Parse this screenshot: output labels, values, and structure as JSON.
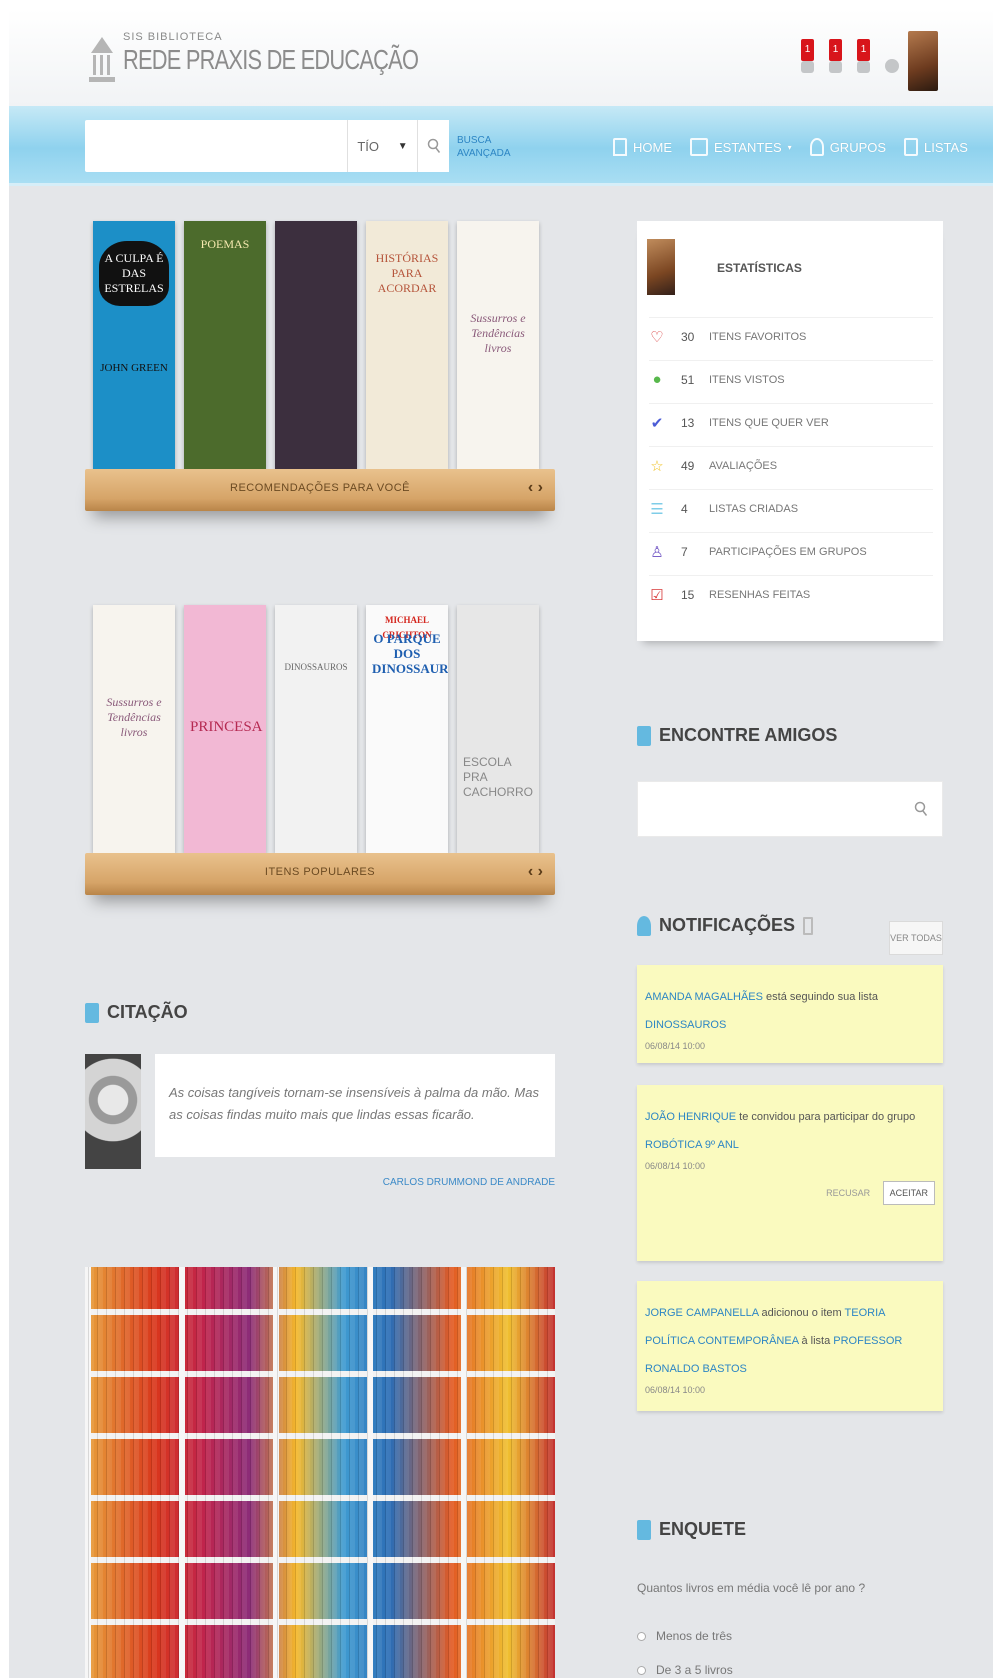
{
  "header": {
    "logo_small": "SIS BIBLIOTECA",
    "logo_big": "REDE PRAXIS DE EDUCAÇÃO",
    "notification_counts": [
      "1",
      "1",
      "1"
    ]
  },
  "navbar": {
    "search_placeholder": "",
    "search_select_value": "TÍO",
    "advanced_search": [
      "BUSCA",
      "AVANÇADA"
    ],
    "items": [
      "HOME",
      "ESTANTES",
      "GRUPOS",
      "LISTAS"
    ]
  },
  "shelves": [
    {
      "label": "RECOMENDAÇÕES PARA VOCÊ",
      "books": [
        {
          "title": "A CULPA É DAS ESTRELAS",
          "author": "JOHN GREEN",
          "color": "#1c8fc7"
        },
        {
          "title": "POEMAS",
          "author": "",
          "color": "#4c6b2c"
        },
        {
          "title": "",
          "author": "",
          "color": "#3c2f3e"
        },
        {
          "title": "HISTÓRIAS PARA ACORDAR",
          "author": "",
          "color": "#f2ead8"
        },
        {
          "title": "Sussurros e Tendências livros",
          "author": "",
          "color": "#f7f4ee"
        }
      ]
    },
    {
      "label": "ITENS POPULARES",
      "books": [
        {
          "title": "Sussurros e Tendências livros",
          "author": "",
          "color": "#f7f4ee"
        },
        {
          "title": "PRINCESA",
          "author": "",
          "color": "#f2b8d4"
        },
        {
          "title": "DINOSSAUROS",
          "author": "",
          "color": "#f2f2f2"
        },
        {
          "title": "O PARQUE DOS DINOSSAUROS",
          "author": "MICHAEL CRICHTON",
          "color": "#fafafa"
        },
        {
          "title": "ESCOLA PRA CACHORRO",
          "author": "",
          "color": "#e7e7e7"
        }
      ]
    }
  ],
  "citation": {
    "heading": "CITAÇÃO",
    "text": "As coisas tangíveis tornam-se insensíveis à palma da mão. Mas as coisas findas muito mais que lindas essas ficarão.",
    "author": "CARLOS DRUMMOND DE ANDRADE"
  },
  "stats": {
    "title": "ESTATÍSTICAS",
    "rows": [
      {
        "icon": "heart-icon",
        "color": "#d83a3a",
        "count": "30",
        "label": "ITENS FAVORITOS"
      },
      {
        "icon": "eye-icon",
        "color": "#58b84c",
        "count": "51",
        "label": "ITENS VISTOS"
      },
      {
        "icon": "bookmark-icon",
        "color": "#4b5cd6",
        "count": "13",
        "label": "ITENS QUE QUER VER"
      },
      {
        "icon": "star-icon",
        "color": "#f0c020",
        "count": "49",
        "label": "AVALIAÇÕES"
      },
      {
        "icon": "list-icon",
        "color": "#7fcde8",
        "count": "4",
        "label": "LISTAS CRIADAS"
      },
      {
        "icon": "group-icon",
        "color": "#7a60c8",
        "count": "7",
        "label": "PARTICIPAÇÕES EM GRUPOS"
      },
      {
        "icon": "review-icon",
        "color": "#d83a3a",
        "count": "15",
        "label": "RESENHAS FEITAS"
      }
    ]
  },
  "friends": {
    "heading": "ENCONTRE AMIGOS",
    "placeholder": ""
  },
  "notifications": {
    "heading": "NOTIFICAÇÕES",
    "see_all": "VER TODAS",
    "items": [
      {
        "actor": "AMANDA MAGALHÃES",
        "text": " está seguindo sua lista ",
        "target": "DINOSSAUROS",
        "extra": "",
        "extra_target": "",
        "time": "06/08/14 10:00"
      },
      {
        "actor": "JOÃO HENRIQUE",
        "text": " te convidou para participar do grupo ",
        "target": "ROBÓTICA 9º ANL",
        "extra": "",
        "extra_target": "",
        "time": "06/08/14 10:00",
        "reject": "RECUSAR",
        "accept": "ACEITAR"
      },
      {
        "actor": "JORGE CAMPANELLA",
        "text": " adicionou o item ",
        "target": "TEORIA POLÍTICA CONTEMPORÂNEA",
        "extra": " à lista ",
        "extra_target": "PROFESSOR RONALDO BASTOS",
        "time": "06/08/14 10:00"
      }
    ]
  },
  "poll": {
    "heading": "ENQUETE",
    "question": "Quantos livros em média você lê por ano ?",
    "options": [
      "Menos de três",
      "De 3 a 5 livros"
    ]
  }
}
